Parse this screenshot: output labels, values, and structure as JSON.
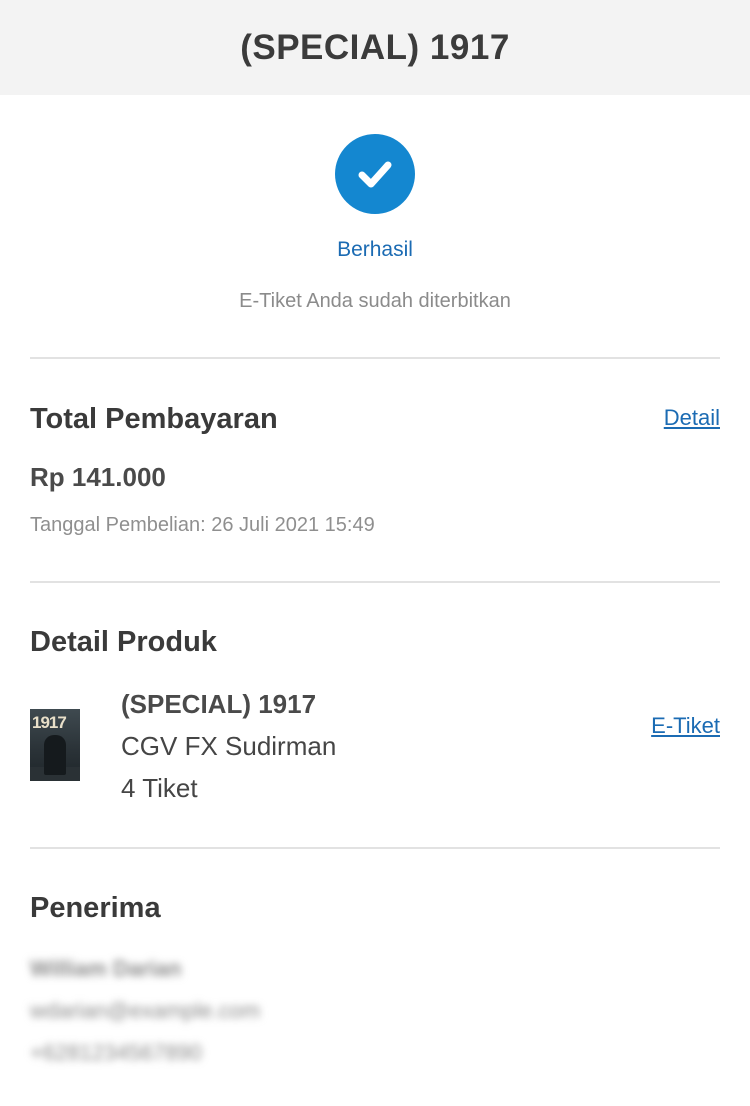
{
  "header": {
    "title": "(SPECIAL) 1917"
  },
  "status": {
    "icon": "check-circle-icon",
    "label": "Berhasil",
    "message": "E-Tiket Anda sudah diterbitkan",
    "accent_color": "#1487d0"
  },
  "payment": {
    "section_title": "Total Pembayaran",
    "detail_link": "Detail",
    "amount": "Rp 141.000",
    "purchase_date": "Tanggal Pembelian: 26 Juli 2021 15:49"
  },
  "product": {
    "section_title": "Detail Produk",
    "poster_text": "1917",
    "title": "(SPECIAL) 1917",
    "cinema": "CGV FX Sudirman",
    "quantity": "4 Tiket",
    "eticket_link": "E-Tiket"
  },
  "recipient": {
    "section_title": "Penerima",
    "name": "William Darian",
    "email": "wdarian@example.com",
    "phone": "+6281234567890"
  }
}
